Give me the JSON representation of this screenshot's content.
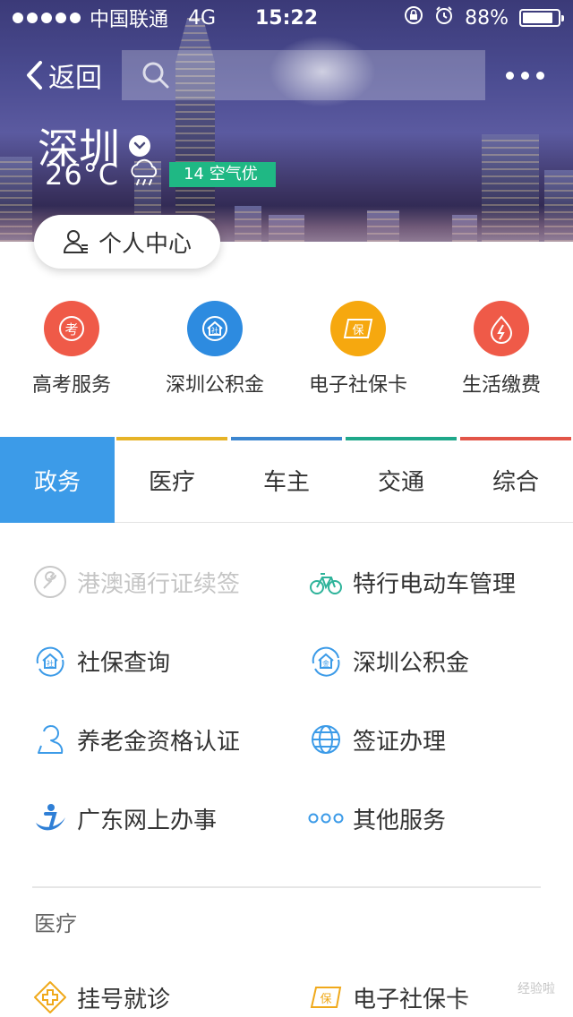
{
  "status": {
    "carrier": "中国联通",
    "network": "4G",
    "time": "15:22",
    "battery": "88%",
    "battery_level": 0.88
  },
  "nav": {
    "back_label": "返回",
    "search_placeholder": ""
  },
  "city": {
    "name": "深圳",
    "temperature": "26°C",
    "aqi": "14 空气优"
  },
  "personal_center": "个人中心",
  "quick_services": [
    {
      "label": "高考服务",
      "icon": "exam-icon",
      "color": "#ef5a48"
    },
    {
      "label": "深圳公积金",
      "icon": "housing-fund-icon",
      "color": "#2d8be0"
    },
    {
      "label": "电子社保卡",
      "icon": "social-security-card-icon",
      "color": "#f6a80f"
    },
    {
      "label": "生活缴费",
      "icon": "bill-payment-icon",
      "color": "#ef5a48"
    }
  ],
  "tabs": [
    {
      "label": "政务",
      "active": true,
      "color": "#3c9be8"
    },
    {
      "label": "医疗",
      "active": false,
      "color": "#e6b327"
    },
    {
      "label": "车主",
      "active": false,
      "color": "#3c86d0"
    },
    {
      "label": "交通",
      "active": false,
      "color": "#1fa88a"
    },
    {
      "label": "综合",
      "active": false,
      "color": "#e25548"
    }
  ],
  "government_services": [
    {
      "label": "港澳通行证续签",
      "icon": "wrench-icon",
      "disabled": true
    },
    {
      "label": "特行电动车管理",
      "icon": "bicycle-icon",
      "disabled": false
    },
    {
      "label": "社保查询",
      "icon": "social-security-icon",
      "disabled": false
    },
    {
      "label": "深圳公积金",
      "icon": "housing-fund-icon",
      "disabled": false
    },
    {
      "label": "养老金资格认证",
      "icon": "person-icon",
      "disabled": false
    },
    {
      "label": "签证办理",
      "icon": "globe-icon",
      "disabled": false
    },
    {
      "label": "广东网上办事",
      "icon": "guangdong-online-icon",
      "disabled": false
    },
    {
      "label": "其他服务",
      "icon": "more-dots-icon",
      "disabled": false
    }
  ],
  "medical_section": {
    "title": "医疗",
    "items": [
      {
        "label": "挂号就诊",
        "icon": "medical-cross-icon"
      },
      {
        "label": "电子社保卡",
        "icon": "social-security-card-icon"
      }
    ]
  },
  "watermark": "经验啦"
}
